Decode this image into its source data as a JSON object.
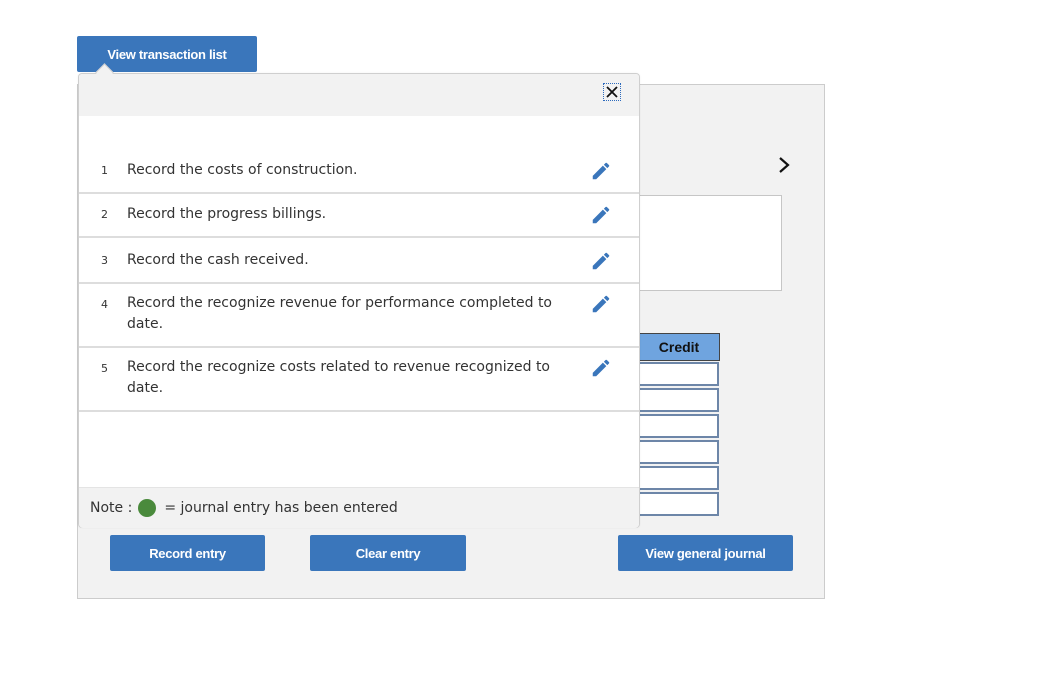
{
  "toolbar": {
    "view_transaction_list_label": "View transaction list"
  },
  "popup": {
    "close_icon": "close-icon",
    "transactions": [
      {
        "num": "1",
        "text": "Record the costs of construction.",
        "icon": "pencil-icon"
      },
      {
        "num": "2",
        "text": "Record the progress billings.",
        "icon": "pencil-icon"
      },
      {
        "num": "3",
        "text": "Record the cash received.",
        "icon": "pencil-icon"
      },
      {
        "num": "4",
        "text": "Record the recognize revenue for performance completed to date.",
        "icon": "pencil-icon"
      },
      {
        "num": "5",
        "text": "Record the recognize costs related to revenue recognized to date.",
        "icon": "pencil-icon"
      }
    ],
    "note": {
      "label": "Note :",
      "text": "= journal entry has been entered",
      "dot_color": "#4a8a3c"
    }
  },
  "journal": {
    "next_icon": "chevron-right-icon",
    "credit_header": "Credit",
    "credit_values": [
      "",
      "",
      "",
      "",
      "",
      ""
    ]
  },
  "actions": {
    "record_entry_label": "Record entry",
    "clear_entry_label": "Clear entry",
    "view_general_journal_label": "View general journal"
  },
  "colors": {
    "accent": "#3a76bb",
    "credit_header_bg": "#6fa4df",
    "panel_bg": "#f2f2f2"
  }
}
